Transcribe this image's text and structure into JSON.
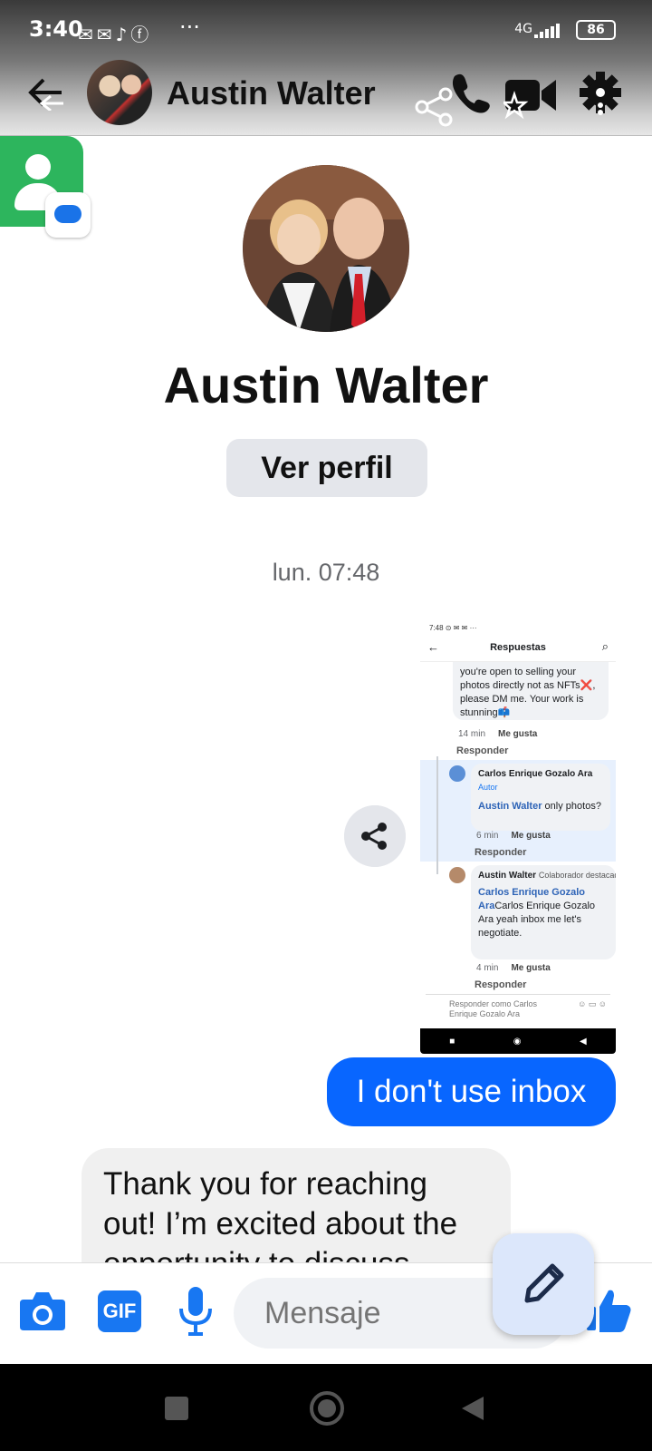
{
  "status_bar": {
    "time": "3:40",
    "more": "···",
    "network": "4G",
    "battery": "86"
  },
  "header": {
    "contact_name": "Austin Walter"
  },
  "profile": {
    "name": "Austin Walter",
    "view_profile_label": "Ver perfil"
  },
  "conversation": {
    "timestamp": "lun. 07:48",
    "shared_screenshot": {
      "status_time": "7:48",
      "title": "Respuestas",
      "first_comment_text": "you're open to selling your photos directly not as NFTs❌, please DM me. Your work is stunning📫",
      "first_comment_time": "14 min",
      "like_label": "Me gusta",
      "reply_label": "Responder",
      "second_author": "Carlos Enrique Gozalo Ara",
      "second_author_tag": "Autor",
      "second_mention": "Austin Walter",
      "second_text": " only photos?",
      "second_time": "6 min",
      "third_author": "Austin Walter",
      "third_author_tag": "Colaborador destacado",
      "third_mention": "Carlos Enrique Gozalo Ara",
      "third_text": "Carlos Enrique Gozalo Ara yeah inbox me let's negotiate.",
      "third_time": "4 min",
      "reply_placeholder": "Responder como Carlos Enrique Gozalo Ara"
    },
    "outgoing_message": "I don't use inbox",
    "incoming_message": "Thank you for reaching out! I’m excited about the opportunity to discuss"
  },
  "composer": {
    "gif_label": "GIF",
    "message_placeholder": "Mensaje"
  },
  "colors": {
    "messenger_blue": "#0866ff",
    "like_blue": "#1877f2",
    "contact_green": "#2db55d"
  }
}
